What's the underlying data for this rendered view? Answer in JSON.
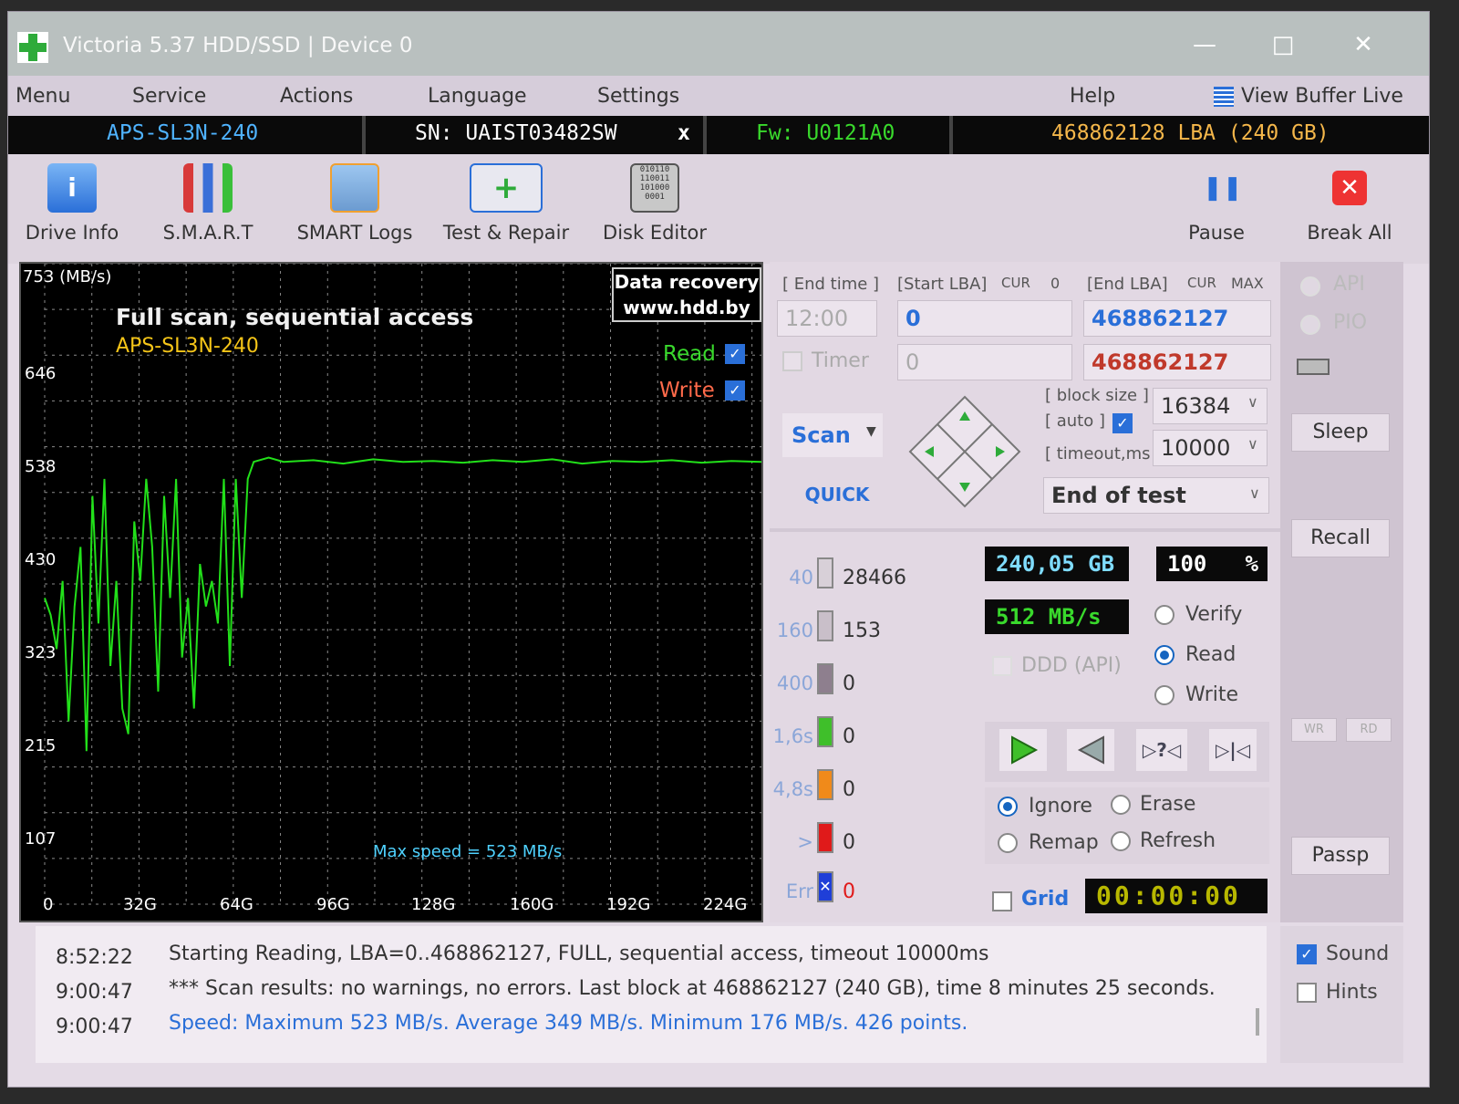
{
  "window": {
    "title": "Victoria 5.37 HDD/SSD | Device 0"
  },
  "menu": {
    "items": [
      "Menu",
      "Service",
      "Actions",
      "Language",
      "Settings",
      "Help"
    ],
    "view_buffer": "View Buffer Live"
  },
  "info": {
    "model": "APS-SL3N-240",
    "serial": "SN: UAIST03482SW",
    "close": "x",
    "firmware": "Fw: U0121A0",
    "capacity": "468862128 LBA (240 GB)"
  },
  "toolbar": {
    "drive_info": "Drive Info",
    "smart": "S.M.A.R.T",
    "smart_logs": "SMART Logs",
    "test_repair": "Test & Repair",
    "disk_editor": "Disk Editor",
    "pause": "Pause",
    "break_all": "Break All"
  },
  "graph": {
    "watermark1": "Data recovery",
    "watermark2": "www.hdd.by",
    "title": "Full scan, sequential access",
    "model": "APS-SL3N-240",
    "read_label": "Read",
    "write_label": "Write",
    "max_speed": "Max speed = 523 MB/s",
    "y_unit": "753 (MB/s)",
    "y_ticks": [
      "646",
      "538",
      "430",
      "323",
      "215",
      "107"
    ],
    "x_ticks": [
      "0",
      "32G",
      "64G",
      "96G",
      "128G",
      "160G",
      "192G",
      "224G"
    ]
  },
  "chart_data": {
    "type": "line",
    "title": "Full scan, sequential access",
    "ylabel": "753 (MB/s)",
    "ylim": [
      0,
      753
    ],
    "xlim": [
      0,
      240
    ],
    "x_ticks": [
      "0",
      "32G",
      "64G",
      "96G",
      "128G",
      "160G",
      "192G",
      "224G"
    ],
    "grid": true,
    "series": [
      {
        "name": "Read",
        "color": "#22e01a",
        "x": [
          0,
          2,
          4,
          6,
          8,
          10,
          12,
          14,
          16,
          18,
          20,
          22,
          24,
          26,
          28,
          30,
          32,
          34,
          36,
          38,
          40,
          42,
          44,
          46,
          48,
          50,
          52,
          54,
          56,
          58,
          60,
          62,
          64,
          66,
          68,
          70,
          75,
          80,
          90,
          100,
          110,
          120,
          130,
          140,
          150,
          160,
          170,
          180,
          190,
          200,
          210,
          220,
          230,
          240
        ],
        "y": [
          360,
          340,
          300,
          380,
          215,
          350,
          420,
          180,
          480,
          330,
          500,
          280,
          380,
          230,
          200,
          450,
          380,
          500,
          420,
          250,
          480,
          360,
          500,
          290,
          360,
          230,
          400,
          350,
          380,
          330,
          500,
          280,
          500,
          360,
          500,
          520,
          525,
          520,
          522,
          518,
          523,
          520,
          521,
          519,
          522,
          520,
          523,
          518,
          521,
          520,
          522,
          519,
          521,
          520
        ]
      }
    ]
  },
  "controls": {
    "end_time_label": "[ End time ]",
    "end_time": "12:00",
    "timer": "Timer",
    "start_lba_label": "[Start LBA]",
    "cur": "CUR",
    "start_cur": "0",
    "start_lba": "0",
    "start_timer": "0",
    "end_lba_label": "[End LBA]",
    "max": "MAX",
    "end_lba": "468862127",
    "end_lba2": "468862127",
    "block_size_label": "[ block size ]",
    "block_size": "16384",
    "auto_label": "[ auto ]",
    "timeout_label": "[ timeout,ms ]",
    "timeout": "10000",
    "scan": "Scan",
    "quick": "QUICK",
    "end_action": "End of test",
    "size": "240,05 GB",
    "percent": "100",
    "percent_sign": "%",
    "speed": "512 MB/s",
    "ddd": "DDD (API)",
    "verify": "Verify",
    "read": "Read",
    "write": "Write",
    "ignore": "Ignore",
    "erase": "Erase",
    "remap": "Remap",
    "refresh": "Refresh",
    "grid": "Grid",
    "timer_display": "00:00:00"
  },
  "sectors": [
    {
      "label": "40",
      "count": "28466",
      "color": "#d8d0d8"
    },
    {
      "label": "160",
      "count": "153",
      "color": "#c9bfc9"
    },
    {
      "label": "400",
      "count": "0",
      "color": "#8e7f8e"
    },
    {
      "label": "1,6s",
      "count": "0",
      "color": "#3fbf2a"
    },
    {
      "label": "4,8s",
      "count": "0",
      "color": "#f08a1a"
    },
    {
      "label": ">",
      "count": "0",
      "color": "#e01a1a"
    },
    {
      "label": "Err",
      "count": "0",
      "color": "#1f3fd8"
    }
  ],
  "side": {
    "api": "API",
    "pio": "PIO",
    "sleep": "Sleep",
    "recall": "Recall",
    "wr": "WR",
    "rd": "RD",
    "passp": "Passp"
  },
  "log": [
    {
      "time": "8:52:22",
      "msg": "Starting Reading, LBA=0..468862127, FULL, sequential access, timeout 10000ms"
    },
    {
      "time": "9:00:47",
      "msg": "*** Scan results: no warnings, no errors. Last block at 468862127 (240 GB), time 8 minutes 25 seconds."
    },
    {
      "time": "9:00:47",
      "msg": "Speed: Maximum 523 MB/s. Average 349 MB/s. Minimum 176 MB/s. 426 points."
    }
  ],
  "options": {
    "sound": "Sound",
    "hints": "Hints"
  }
}
